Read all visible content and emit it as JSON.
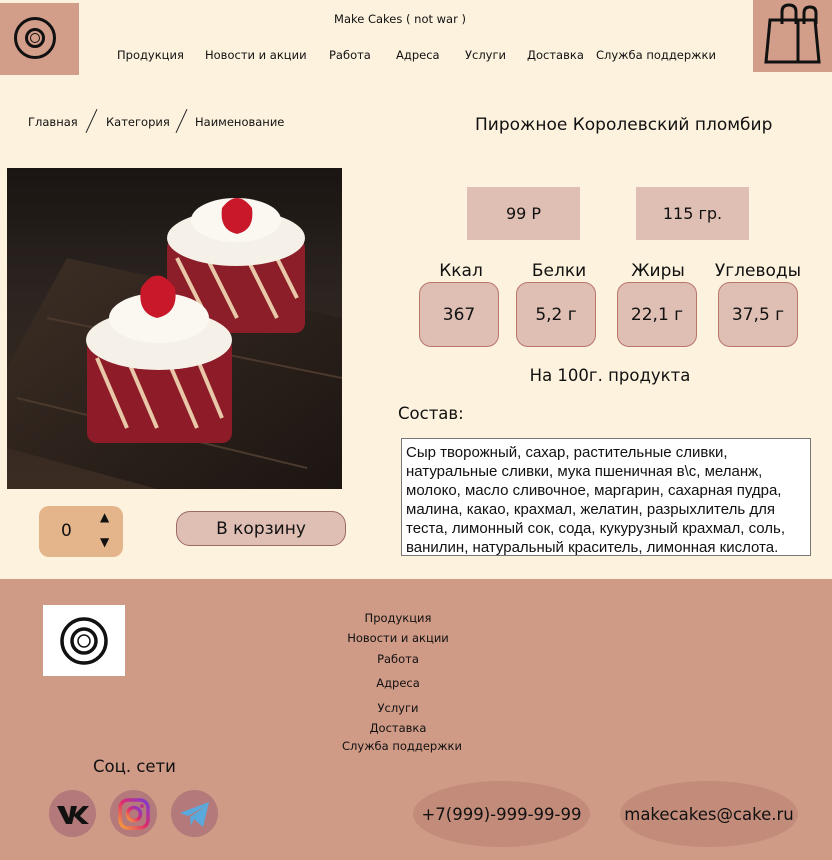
{
  "header": {
    "tagline": "Make Cakes ( not war )",
    "nav": [
      "Продукция",
      "Новости и акции",
      "Работа",
      "Адреса",
      "Услуги",
      "Доставка",
      "Служба поддержки"
    ]
  },
  "breadcrumb": [
    "Главная",
    "Категория",
    "Наименование"
  ],
  "product": {
    "title": "Пирожное Королевский пломбир",
    "price": "99 Р",
    "weight": "115 гр.",
    "nutrition": [
      {
        "label": "Ккал",
        "value": "367"
      },
      {
        "label": "Белки",
        "value": "5,2 г"
      },
      {
        "label": "Жиры",
        "value": "22,1 г"
      },
      {
        "label": "Углеводы",
        "value": "37,5 г"
      }
    ],
    "per100": "На 100г. продукта",
    "composition_label": "Состав:",
    "composition": "Сыр творожный, сахар, растительные сливки, натуральные сливки, мука пшеничная в\\с, меланж, молоко, масло сливочное, маргарин, сахарная пудра, малина, какао, крахмал, желатин, разрыхлитель для теста, лимонный сок, сода, кукурузный крахмал, соль, ванилин, натуральный краситель, лимонная кислота.",
    "quantity": "0",
    "cart_button": "В корзину"
  },
  "footer": {
    "links": [
      "Продукция",
      "Новости и акции",
      "Работа",
      "Адреса",
      "Услуги",
      "Доставка",
      "Служба поддержки"
    ],
    "social_title": "Соц. сети",
    "social": [
      "vk-icon",
      "instagram-icon",
      "telegram-icon"
    ],
    "phone": "+7(999)-999-99-99",
    "email": "makecakes@cake.ru"
  },
  "colors": {
    "background": "#fdf2de",
    "accent": "#d29e8a",
    "footer": "#cf9a86",
    "tag": "#dfbfb4",
    "stepper": "#e4b48a"
  }
}
